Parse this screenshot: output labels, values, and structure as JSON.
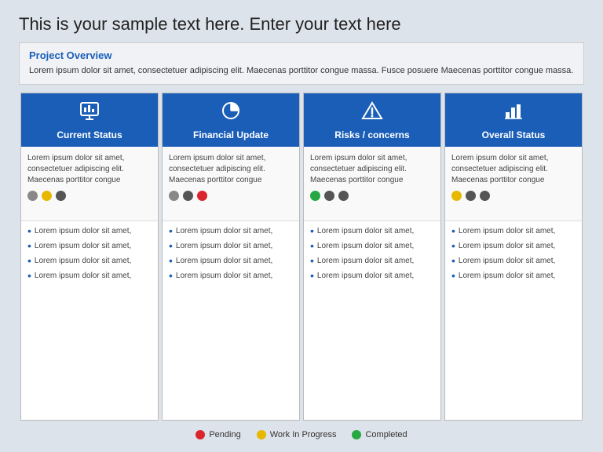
{
  "page": {
    "main_title": "This is your sample text here. Enter your text here"
  },
  "project_overview": {
    "title": "Project Overview",
    "text": "Lorem ipsum dolor sit amet, consectetuer adipiscing elit. Maecenas porttitor congue massa. Fusce posuere Maecenas porttitor congue massa."
  },
  "columns": [
    {
      "id": "current-status",
      "icon": "📊",
      "icon_name": "chart-icon",
      "label": "Current Status",
      "status_text": "Lorem ipsum dolor sit amet, consectetuer adipiscing elit. Maecenas porttitor congue",
      "dots": [
        "gray",
        "yellow",
        "dark-gray"
      ],
      "bullets": [
        "Lorem ipsum dolor sit amet,",
        "Lorem ipsum dolor sit amet,",
        "Lorem ipsum dolor sit amet,",
        "Lorem ipsum dolor sit amet,"
      ]
    },
    {
      "id": "financial-update",
      "icon": "🥧",
      "icon_name": "pie-chart-icon",
      "label": "Financial Update",
      "status_text": "Lorem ipsum dolor sit amet, consectetuer adipiscing elit. Maecenas porttitor congue",
      "dots": [
        "gray",
        "dark-gray",
        "red"
      ],
      "bullets": [
        "Lorem ipsum dolor sit amet,",
        "Lorem ipsum dolor sit amet,",
        "Lorem ipsum dolor sit amet,",
        "Lorem ipsum dolor sit amet,"
      ]
    },
    {
      "id": "risks-concerns",
      "icon": "⚠",
      "icon_name": "warning-icon",
      "label": "Risks / concerns",
      "status_text": "Lorem ipsum dolor sit amet, consectetuer adipiscing elit. Maecenas porttitor congue",
      "dots": [
        "green",
        "dark-gray",
        "dark-gray"
      ],
      "bullets": [
        "Lorem ipsum dolor sit amet,",
        "Lorem ipsum dolor sit amet,",
        "Lorem ipsum dolor sit amet,",
        "Lorem ipsum dolor sit amet,"
      ]
    },
    {
      "id": "overall-status",
      "icon": "📈",
      "icon_name": "bar-chart-icon",
      "label": "Overall Status",
      "status_text": "Lorem ipsum dolor sit amet, consectetuer adipiscing elit. Maecenas porttitor congue",
      "dots": [
        "yellow",
        "dark-gray",
        "dark-gray"
      ],
      "bullets": [
        "Lorem ipsum dolor sit amet,",
        "Lorem ipsum dolor sit amet,",
        "Lorem ipsum dolor sit amet,",
        "Lorem ipsum dolor sit amet,"
      ]
    }
  ],
  "legend": {
    "items": [
      {
        "color": "red",
        "label": "Pending"
      },
      {
        "color": "yellow",
        "label": "Work In Progress"
      },
      {
        "color": "green",
        "label": "Completed"
      }
    ]
  }
}
